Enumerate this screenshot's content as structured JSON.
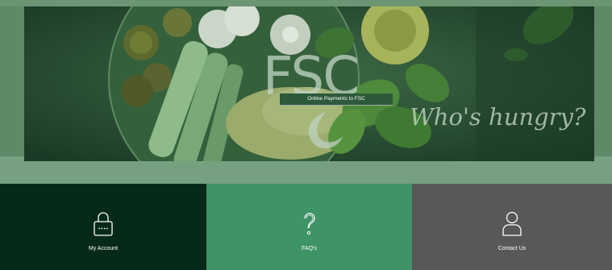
{
  "hero": {
    "logo_text": "FSC",
    "caption": "Online Payments to FSC",
    "tagline": "Who's hungry?"
  },
  "tiles": [
    {
      "label": "My Account",
      "icon": "lock-icon",
      "color": "#062a18"
    },
    {
      "label": "FAQ's",
      "icon": "question-mark-icon",
      "color": "#3f9466"
    },
    {
      "label": "Contact Us",
      "icon": "person-icon",
      "color": "#585858"
    }
  ]
}
